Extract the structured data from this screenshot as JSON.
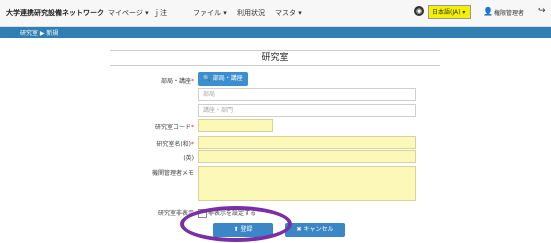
{
  "header": {
    "brand": "大学連携研究設備ネットワーク",
    "menu": [
      "マイページ ▾",
      "ｊ注",
      "ファイル ▾",
      "利用状況",
      "マスタ ▾"
    ],
    "language": "日本語(JA) ▾",
    "user": "権限管理者"
  },
  "breadcrumb": [
    "研究室 ▶ 新規"
  ],
  "form": {
    "title": "研究室",
    "dept_label": "部局・講座",
    "search_button": "部局・講座",
    "dept_placeholder": "部局",
    "course_placeholder": "講座・部門",
    "code_label": "研究室コード",
    "name_label": "研究室名(和)",
    "name_en_label": "(英)",
    "memo_label": "機関管理者メモ",
    "flag_label": "研究室非表示",
    "flag_text": "非表示を設定する"
  },
  "buttons": {
    "save": "登録",
    "cancel": "キャンセル"
  },
  "colors": {
    "topbar": "#f7f7f7",
    "crumb": "#2e7fb4",
    "button": "#3a86c6",
    "field_highlight": "#fbf8b8",
    "annotation": "#7b2fa6"
  }
}
